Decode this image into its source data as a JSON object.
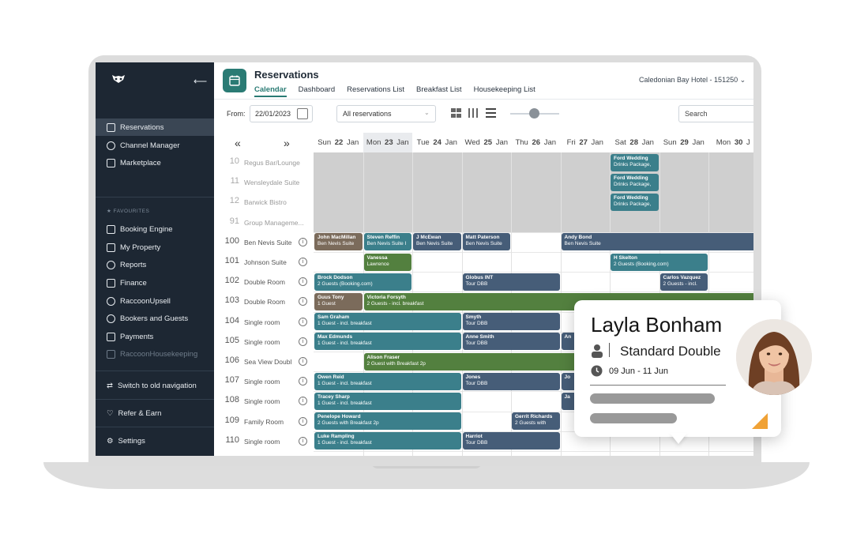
{
  "colors": {
    "sidebar": "#1d2733",
    "teal": "#2a7b74",
    "booking_teal": "#3b7f8b",
    "booking_navy": "#465d78",
    "booking_green": "#53803f",
    "booking_brown": "#7b6b5b",
    "blocked": "#cfcfcf",
    "accent_orange": "#f0a236"
  },
  "sidebar": {
    "nav": [
      {
        "label": "Reservations",
        "icon": "calendar-icon"
      },
      {
        "label": "Channel Manager",
        "icon": "bell-icon"
      },
      {
        "label": "Marketplace",
        "icon": "grid-icon"
      }
    ],
    "favourites_heading": "FAVOURITES",
    "favourites": [
      {
        "label": "Booking Engine",
        "icon": "cart-icon"
      },
      {
        "label": "My Property",
        "icon": "building-icon"
      },
      {
        "label": "Reports",
        "icon": "chart-icon"
      },
      {
        "label": "Finance",
        "icon": "finance-icon"
      },
      {
        "label": "RaccoonUpsell",
        "icon": "plus-circle-icon"
      },
      {
        "label": "Bookers and Guests",
        "icon": "users-icon"
      },
      {
        "label": "Payments",
        "icon": "card-icon"
      },
      {
        "label": "RaccoonHousekeeping",
        "icon": "broom-icon"
      }
    ],
    "switch_label": "Switch to old navigation",
    "refer_label": "Refer & Earn",
    "settings_label": "Settings"
  },
  "header": {
    "title": "Reservations",
    "tabs": [
      "Calendar",
      "Dashboard",
      "Reservations List",
      "Breakfast List",
      "Housekeeping List"
    ],
    "active_tab": "Calendar",
    "hotel": "Caledonian Bay Hotel - 151250"
  },
  "toolbar": {
    "from_label": "From:",
    "from_date": "22/01/2023",
    "filter_value": "All reservations",
    "search_placeholder": "Search"
  },
  "days": [
    {
      "dow": "Sun",
      "num": "22",
      "mon": "Jan"
    },
    {
      "dow": "Mon",
      "num": "23",
      "mon": "Jan"
    },
    {
      "dow": "Tue",
      "num": "24",
      "mon": "Jan"
    },
    {
      "dow": "Wed",
      "num": "25",
      "mon": "Jan"
    },
    {
      "dow": "Thu",
      "num": "26",
      "mon": "Jan"
    },
    {
      "dow": "Fri",
      "num": "27",
      "mon": "Jan"
    },
    {
      "dow": "Sat",
      "num": "28",
      "mon": "Jan"
    },
    {
      "dow": "Sun",
      "num": "29",
      "mon": "Jan"
    },
    {
      "dow": "Mon",
      "num": "30",
      "mon": "J"
    }
  ],
  "rooms": [
    {
      "num": "10",
      "name": "Regus Bar/Lounge",
      "info": false,
      "dim": true
    },
    {
      "num": "11",
      "name": "Wensleydale Suite",
      "info": false,
      "dim": true
    },
    {
      "num": "12",
      "name": "Barwick Bistro",
      "info": false,
      "dim": true
    },
    {
      "num": "91",
      "name": "Group Manageme...",
      "info": false,
      "dim": true
    },
    {
      "num": "100",
      "name": "Ben Nevis Suite",
      "info": true,
      "dim": false
    },
    {
      "num": "101",
      "name": "Johnson Suite",
      "info": true,
      "dim": false
    },
    {
      "num": "102",
      "name": "Double Room",
      "info": true,
      "dim": false
    },
    {
      "num": "103",
      "name": "Double Room",
      "info": true,
      "dim": false
    },
    {
      "num": "104",
      "name": "Single room",
      "info": true,
      "dim": false
    },
    {
      "num": "105",
      "name": "Single room",
      "info": true,
      "dim": false
    },
    {
      "num": "106",
      "name": "Sea View Doubl",
      "info": true,
      "dim": false
    },
    {
      "num": "107",
      "name": "Single room",
      "info": true,
      "dim": false
    },
    {
      "num": "108",
      "name": "Single room",
      "info": true,
      "dim": false
    },
    {
      "num": "109",
      "name": "Family Room",
      "info": true,
      "dim": false
    },
    {
      "num": "110",
      "name": "Single room",
      "info": true,
      "dim": false
    }
  ],
  "bookings": [
    {
      "row": 0,
      "start": 6,
      "span": 1,
      "name": "Ford Wedding",
      "sub": "Drinks Package,",
      "color": "booking_teal"
    },
    {
      "row": 1,
      "start": 6,
      "span": 1,
      "name": "Ford Wedding",
      "sub": "Drinks Package,",
      "color": "booking_teal"
    },
    {
      "row": 2,
      "start": 6,
      "span": 1,
      "name": "Ford Wedding",
      "sub": "Drinks Package,",
      "color": "booking_teal"
    },
    {
      "row": 4,
      "start": 0,
      "span": 1,
      "name": "John MacMillan",
      "sub": "Ben Nevis Suite",
      "color": "booking_brown"
    },
    {
      "row": 4,
      "start": 1,
      "span": 1,
      "name": "Steven Reffin",
      "sub": "Ben Nevis Suite I",
      "color": "booking_teal"
    },
    {
      "row": 4,
      "start": 2,
      "span": 1,
      "name": "J McEwan",
      "sub": "Ben Nevis Suite",
      "color": "booking_navy"
    },
    {
      "row": 4,
      "start": 3,
      "span": 1,
      "name": "Matt Paterson",
      "sub": "Ben Nevis Suite",
      "color": "booking_navy"
    },
    {
      "row": 4,
      "start": 5,
      "span": 4,
      "name": "Andy Bond",
      "sub": "Ben Nevis Suite",
      "color": "booking_navy"
    },
    {
      "row": 5,
      "start": 1,
      "span": 1,
      "name": "Vanessa",
      "sub": "Lawrence",
      "color": "booking_green"
    },
    {
      "row": 5,
      "start": 6,
      "span": 2,
      "name": "H Skelton",
      "sub": "2 Guests (Booking.com)",
      "color": "booking_teal"
    },
    {
      "row": 6,
      "start": 0,
      "span": 2,
      "name": "Brock Dodson",
      "sub": "2 Guests (Booking.com)",
      "color": "booking_teal"
    },
    {
      "row": 6,
      "start": 3,
      "span": 2,
      "name": "Globus INT",
      "sub": "Tour DBB",
      "color": "booking_navy"
    },
    {
      "row": 6,
      "start": 7,
      "span": 1,
      "name": "Carlos Vazquez",
      "sub": "2 Guests - incl.",
      "color": "booking_navy"
    },
    {
      "row": 7,
      "start": 0,
      "span": 1,
      "name": "Guus Tony",
      "sub": "1 Guest",
      "color": "booking_brown"
    },
    {
      "row": 7,
      "start": 1,
      "span": 8,
      "name": "Victoria Forsyth",
      "sub": "2 Guests - incl. breakfast",
      "color": "booking_green"
    },
    {
      "row": 8,
      "start": 0,
      "span": 3,
      "name": "Sam Graham",
      "sub": "1 Guest - incl. breakfast",
      "color": "booking_teal"
    },
    {
      "row": 8,
      "start": 3,
      "span": 2,
      "name": "Smyth",
      "sub": "Tour DBB",
      "color": "booking_navy"
    },
    {
      "row": 9,
      "start": 0,
      "span": 3,
      "name": "Max Edmunds",
      "sub": "1 Guest - incl. breakfast",
      "color": "booking_teal"
    },
    {
      "row": 9,
      "start": 3,
      "span": 2,
      "name": "Anne Smith",
      "sub": "Tour DBB",
      "color": "booking_navy"
    },
    {
      "row": 9,
      "start": 5,
      "span": 1,
      "name": "An",
      "sub": "",
      "color": "booking_navy"
    },
    {
      "row": 10,
      "start": 1,
      "span": 5,
      "name": "Alison Fraser",
      "sub": "2 Guest with Breakfast 2p",
      "color": "booking_green"
    },
    {
      "row": 11,
      "start": 0,
      "span": 3,
      "name": "Owen Reid",
      "sub": "1 Guest - incl. breakfast",
      "color": "booking_teal"
    },
    {
      "row": 11,
      "start": 3,
      "span": 2,
      "name": "Jones",
      "sub": "Tour DBB",
      "color": "booking_navy"
    },
    {
      "row": 11,
      "start": 5,
      "span": 1,
      "name": "Jo",
      "sub": "",
      "color": "booking_navy"
    },
    {
      "row": 12,
      "start": 0,
      "span": 3,
      "name": "Tracey Sharp",
      "sub": "1 Guest - incl. breakfast",
      "color": "booking_teal"
    },
    {
      "row": 12,
      "start": 5,
      "span": 1,
      "name": "Ja",
      "sub": "",
      "color": "booking_navy"
    },
    {
      "row": 13,
      "start": 0,
      "span": 3,
      "name": "Penelope Howard",
      "sub": "2 Guests with Breakfast 2p",
      "color": "booking_teal"
    },
    {
      "row": 13,
      "start": 4,
      "span": 1,
      "name": "Gerrit Richards",
      "sub": "2 Guests with",
      "color": "booking_navy"
    },
    {
      "row": 14,
      "start": 0,
      "span": 3,
      "name": "Luke Rampling",
      "sub": "1 Guest - incl. breakfast",
      "color": "booking_teal"
    },
    {
      "row": 14,
      "start": 3,
      "span": 2,
      "name": "Harriot",
      "sub": "Tour DBB",
      "color": "booking_navy"
    }
  ],
  "popup": {
    "guest_name": "Layla Bonham",
    "room_type": "Standard Double",
    "dates": "09 Jun - 11 Jun"
  }
}
